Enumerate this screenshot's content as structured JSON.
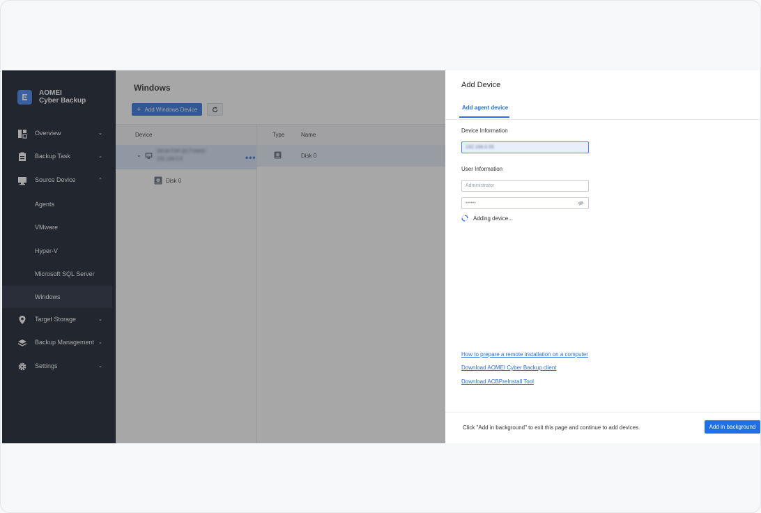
{
  "sidebar": {
    "brand_line1": "AOMEI",
    "brand_line2": "Cyber Backup",
    "items": [
      {
        "label": "Overview",
        "icon": "dashboard-icon"
      },
      {
        "label": "Backup Task",
        "icon": "clipboard-icon"
      },
      {
        "label": "Source Device",
        "icon": "monitor-icon"
      },
      {
        "label": "Target Storage",
        "icon": "location-pin-icon"
      },
      {
        "label": "Backup Management",
        "icon": "layers-icon"
      },
      {
        "label": "Settings",
        "icon": "gear-icon"
      }
    ],
    "sub_items": [
      {
        "label": "Agents"
      },
      {
        "label": "VMware"
      },
      {
        "label": "Hyper-V"
      },
      {
        "label": "Microsoft SQL Server"
      },
      {
        "label": "Windows"
      }
    ]
  },
  "main": {
    "title": "Windows",
    "add_button": "Add Windows Device",
    "table": {
      "headers": {
        "device": "Device",
        "type": "Type",
        "name": "Name"
      },
      "device_name": "DESKTOP-QCTVM4D",
      "device_sub": "192.168.0.6",
      "device_child": "Disk 0",
      "row_name": "Disk 0"
    }
  },
  "drawer": {
    "title": "Add Device",
    "tab": "Add agent device",
    "device_info_label": "Device Information",
    "device_ip_value": "192.168.0.55",
    "user_info_label": "User Information",
    "username_placeholder": "Administrator",
    "password_value": "••••••",
    "status": "Adding device...",
    "links": [
      "How to prepare a remote installation on a computer",
      "Download AOMEI Cyber Backup client",
      "Download ACBPreInstall Tool"
    ],
    "footer_text": "Click \"Add in background\" to exit this page and continue to add devices.",
    "footer_button": "Add in background"
  },
  "colors": {
    "accent": "#2a6fdc",
    "sidebar_bg": "#0c1425"
  }
}
